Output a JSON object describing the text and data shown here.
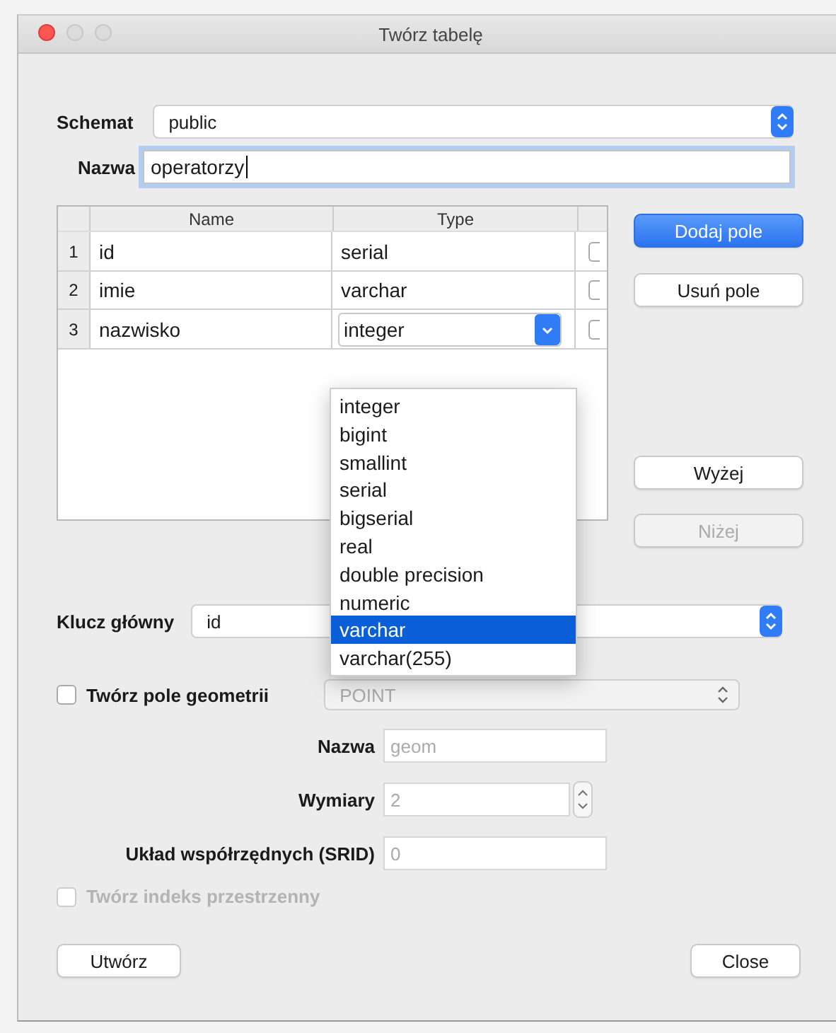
{
  "window": {
    "title": "Twórz tabelę"
  },
  "schema": {
    "label": "Schemat",
    "value": "public"
  },
  "table_name": {
    "label": "Nazwa",
    "value": "operatorzy"
  },
  "table": {
    "columns": [
      "Name",
      "Type"
    ],
    "rows": [
      {
        "number": "1",
        "name": "id",
        "type": "serial",
        "editing": false,
        "checked": false
      },
      {
        "number": "2",
        "name": "imie",
        "type": "varchar",
        "editing": false,
        "checked": false
      },
      {
        "number": "3",
        "name": "nazwisko",
        "type": "integer",
        "editing": true,
        "checked": false
      }
    ]
  },
  "type_dropdown": {
    "items": [
      {
        "label": "integer",
        "selected": false
      },
      {
        "label": "bigint",
        "selected": false
      },
      {
        "label": "smallint",
        "selected": false
      },
      {
        "label": "serial",
        "selected": false
      },
      {
        "label": "bigserial",
        "selected": false
      },
      {
        "label": "real",
        "selected": false
      },
      {
        "label": "double precision",
        "selected": false
      },
      {
        "label": "numeric",
        "selected": false
      },
      {
        "label": "varchar",
        "selected": true
      },
      {
        "label": "varchar(255)",
        "selected": false
      }
    ]
  },
  "side_buttons": [
    {
      "label": "Dodaj pole",
      "kind": "primary",
      "disabled": false
    },
    {
      "label": "Usuń pole",
      "kind": "normal",
      "disabled": false
    },
    {
      "label": "Wyżej",
      "kind": "normal",
      "disabled": false
    },
    {
      "label": "Niżej",
      "kind": "normal",
      "disabled": true
    }
  ],
  "primary_key": {
    "label": "Klucz główny",
    "value": "id"
  },
  "geometry": {
    "label": "Twórz pole geometrii",
    "checked": false,
    "type": "POINT",
    "disabled": true,
    "fields": [
      {
        "label": "Nazwa",
        "value": "geom",
        "kind": "text"
      },
      {
        "label": "Wymiary",
        "value": "2",
        "kind": "spin"
      },
      {
        "label": "Układ współrzędnych (SRID)",
        "value": "0",
        "kind": "text"
      }
    ]
  },
  "spatial_index": {
    "label": "Twórz indeks przestrzenny",
    "checked": false,
    "disabled": true
  },
  "footer_buttons": [
    "Utwórz",
    "Close"
  ]
}
